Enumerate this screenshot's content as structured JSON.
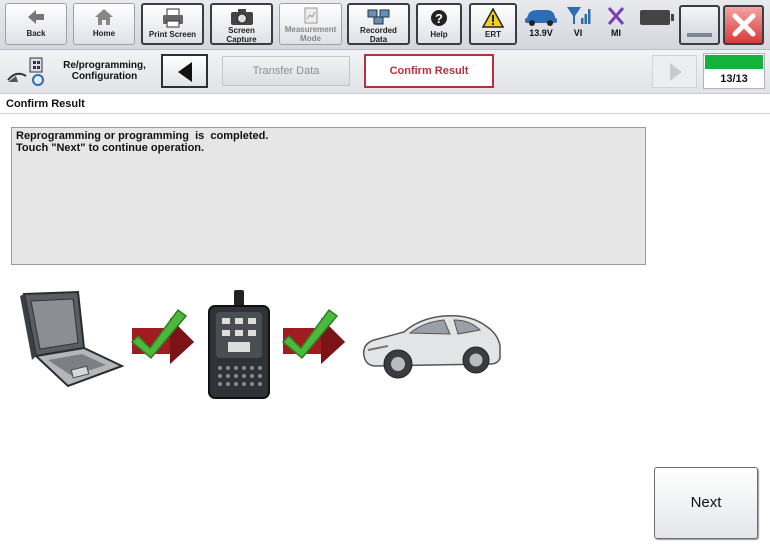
{
  "toolbar": {
    "back": "Back",
    "home": "Home",
    "print_screen": "Print Screen",
    "screen_capture": [
      "Screen",
      "Capture"
    ],
    "measurement_mode": [
      "Measurement",
      "Mode"
    ],
    "recorded_data": [
      "Recorded",
      "Data"
    ],
    "help": "Help",
    "ert": "ERT",
    "voltage": "13.9V",
    "vi": "VI",
    "mi": "MI"
  },
  "navbar": {
    "mode_label": [
      "Re/programming,",
      "Configuration"
    ],
    "steps": [
      "Transfer Data",
      "Confirm Result"
    ],
    "progress": "13/13",
    "progress_fraction": 1.0
  },
  "main": {
    "section_title": "Confirm Result",
    "message_lines": [
      "Reprogramming or programming  is  completed.",
      "Touch \"Next\" to continue operation."
    ],
    "next_label": "Next"
  },
  "colors": {
    "accent_red": "#b3323b",
    "progress_green": "#12b33b",
    "check_green": "#4cb83c"
  }
}
